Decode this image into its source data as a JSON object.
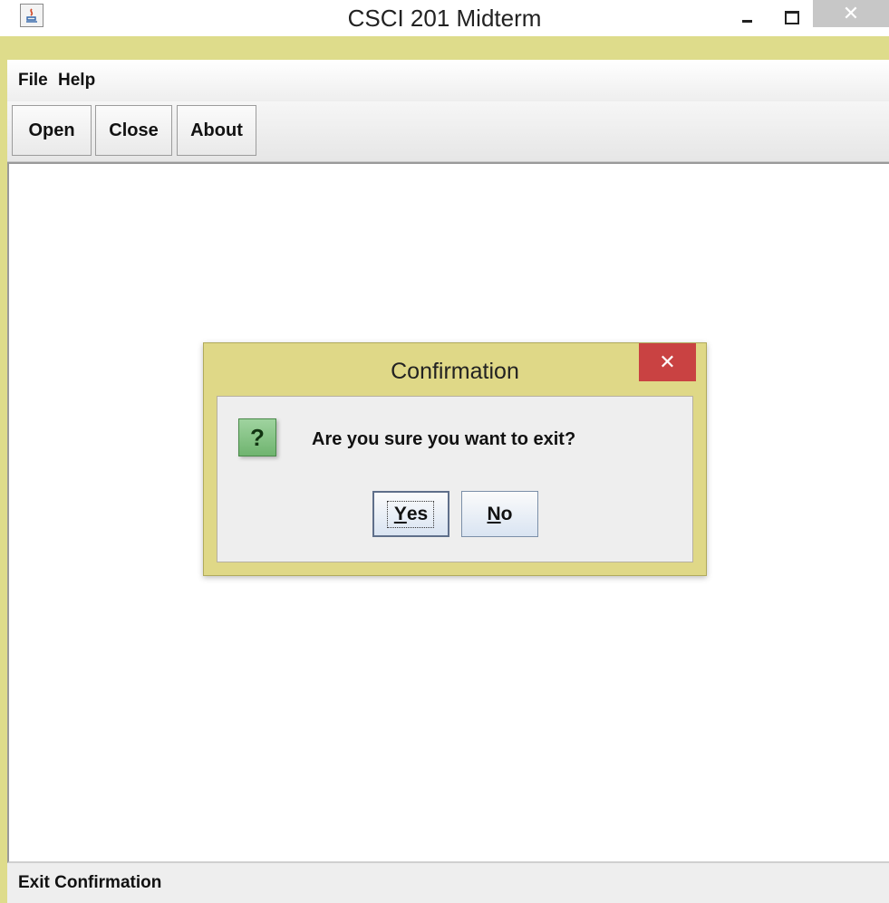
{
  "window": {
    "title": "CSCI 201 Midterm",
    "icon": "java-icon"
  },
  "menubar": {
    "items": [
      {
        "label": "File"
      },
      {
        "label": "Help"
      }
    ]
  },
  "toolbar": {
    "buttons": [
      {
        "label": "Open"
      },
      {
        "label": "Close"
      },
      {
        "label": "About"
      }
    ]
  },
  "statusbar": {
    "text": "Exit Confirmation"
  },
  "dialog": {
    "title": "Confirmation",
    "icon": "question-icon",
    "icon_glyph": "?",
    "message": "Are you sure you want to exit?",
    "buttons": {
      "yes": {
        "mnemonic": "Y",
        "rest": "es"
      },
      "no": {
        "mnemonic": "N",
        "rest": "o"
      }
    },
    "colors": {
      "frame": "#dfd887",
      "close": "#c94242"
    }
  }
}
